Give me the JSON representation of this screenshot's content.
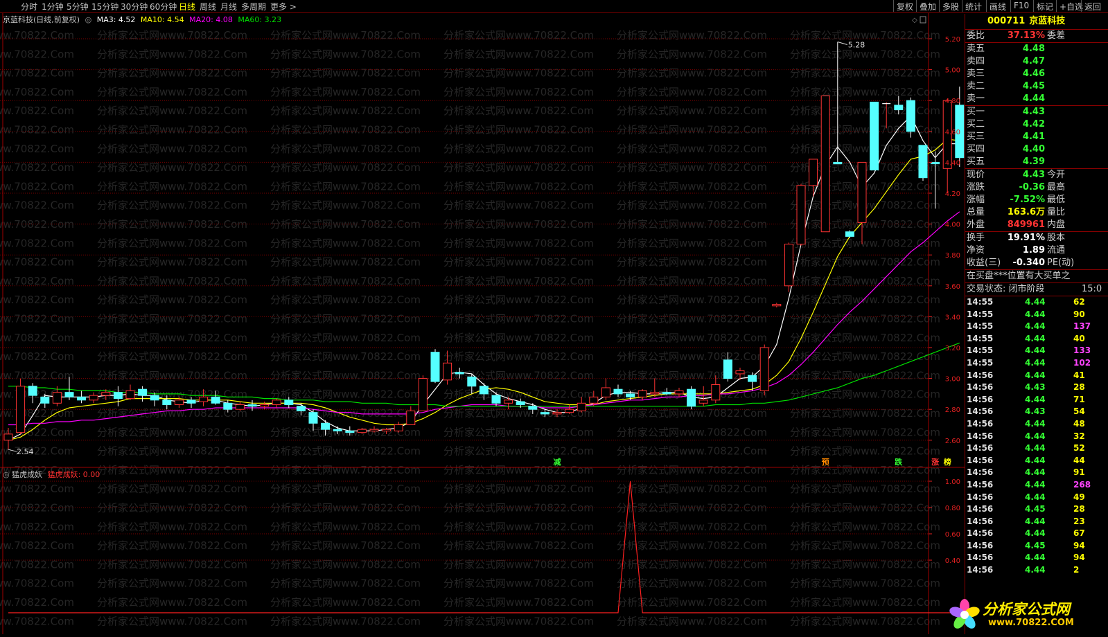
{
  "topbar": {
    "periods": [
      "分时",
      "1分钟",
      "5分钟",
      "15分钟",
      "30分钟",
      "60分钟",
      "日线",
      "周线",
      "月线",
      "多周期",
      "更多"
    ],
    "active_period": "日线",
    "tools": [
      "复权",
      "叠加",
      "多股",
      "统计",
      "画线",
      "F10",
      "标记",
      "+自选",
      "返回"
    ]
  },
  "main_info": {
    "title": "京蓝科技(日线,前复权)",
    "ma3": "MA3: 4.52",
    "ma10": "MA10: 4.54",
    "ma20": "MA20: 4.08",
    "ma60": "MA60: 3.23"
  },
  "indicator_info": {
    "name": "猛虎成妖",
    "value": "猛虎成妖: 0.00"
  },
  "watermark": "分析家公式网www.70822.Com",
  "colors": {
    "up": "#ff3333",
    "down": "#55ffff",
    "ma3": "#ffffff",
    "ma10": "#ffff00",
    "ma20": "#ff00ff",
    "ma60": "#00e000",
    "grid": "#7a0000",
    "indicator": "#ff2020"
  },
  "chart_data": {
    "type": "candlestick",
    "price_axis": {
      "ticks": [
        "5.20",
        "5.00",
        "4.80",
        "4.60",
        "4.40",
        "4.20",
        "4.00",
        "3.80",
        "3.60",
        "3.40",
        "3.20",
        "3.00",
        "2.80",
        "2.60"
      ],
      "range": [
        2.55,
        5.3
      ]
    },
    "indicator_axis": {
      "ticks": [
        "1.00",
        "0.80",
        "0.60",
        "0.40"
      ],
      "range": [
        0,
        1.0
      ]
    },
    "high_label": "5.28",
    "low_label": "2.54",
    "candles": [
      [
        2.6,
        2.64,
        2.54,
        2.68
      ],
      [
        2.65,
        2.95,
        2.64,
        3.0
      ],
      [
        2.95,
        2.89,
        2.84,
        2.97
      ],
      [
        2.88,
        2.84,
        2.81,
        2.9
      ],
      [
        2.84,
        2.91,
        2.82,
        2.95
      ],
      [
        2.91,
        2.88,
        2.86,
        3.01
      ],
      [
        2.88,
        2.86,
        2.84,
        2.92
      ],
      [
        2.86,
        2.89,
        2.84,
        2.91
      ],
      [
        2.89,
        2.91,
        2.86,
        2.93
      ],
      [
        2.91,
        2.87,
        2.82,
        2.95
      ],
      [
        2.87,
        2.92,
        2.86,
        2.96
      ],
      [
        2.93,
        2.89,
        2.85,
        2.95
      ],
      [
        2.89,
        2.86,
        2.82,
        2.91
      ],
      [
        2.86,
        2.83,
        2.8,
        2.89
      ],
      [
        2.83,
        2.86,
        2.81,
        2.88
      ],
      [
        2.86,
        2.84,
        2.81,
        2.88
      ],
      [
        2.85,
        2.88,
        2.82,
        2.93
      ],
      [
        2.88,
        2.84,
        2.83,
        2.92
      ],
      [
        2.84,
        2.8,
        2.78,
        2.86
      ],
      [
        2.8,
        2.83,
        2.79,
        2.85
      ],
      [
        2.83,
        2.82,
        2.79,
        2.86
      ],
      [
        2.82,
        2.83,
        2.8,
        2.85
      ],
      [
        2.83,
        2.86,
        2.81,
        2.87
      ],
      [
        2.86,
        2.83,
        2.81,
        2.88
      ],
      [
        2.82,
        2.79,
        2.76,
        2.84
      ],
      [
        2.78,
        2.71,
        2.66,
        2.8
      ],
      [
        2.71,
        2.67,
        2.63,
        2.73
      ],
      [
        2.67,
        2.66,
        2.64,
        2.69
      ],
      [
        2.66,
        2.65,
        2.63,
        2.69
      ],
      [
        2.65,
        2.67,
        2.64,
        2.68
      ],
      [
        2.66,
        2.67,
        2.65,
        2.69
      ],
      [
        2.66,
        2.67,
        2.64,
        2.68
      ],
      [
        2.66,
        2.7,
        2.65,
        2.72
      ],
      [
        2.7,
        2.79,
        2.7,
        2.82
      ],
      [
        2.79,
        3.0,
        2.79,
        3.02
      ],
      [
        3.17,
        2.98,
        2.97,
        3.19
      ],
      [
        2.99,
        3.1,
        2.96,
        3.18
      ],
      [
        3.04,
        3.03,
        3.0,
        3.07
      ],
      [
        3.01,
        2.95,
        2.9,
        3.03
      ],
      [
        2.95,
        2.9,
        2.86,
        2.97
      ],
      [
        2.89,
        2.84,
        2.82,
        2.91
      ],
      [
        2.84,
        2.86,
        2.8,
        2.88
      ],
      [
        2.85,
        2.83,
        2.81,
        2.87
      ],
      [
        2.82,
        2.8,
        2.77,
        2.84
      ],
      [
        2.78,
        2.77,
        2.75,
        2.8
      ],
      [
        2.77,
        2.78,
        2.75,
        2.8
      ],
      [
        2.78,
        2.8,
        2.77,
        2.83
      ],
      [
        2.79,
        2.84,
        2.78,
        2.88
      ],
      [
        2.84,
        2.88,
        2.82,
        2.92
      ],
      [
        2.88,
        2.94,
        2.86,
        3.0
      ],
      [
        2.93,
        2.9,
        2.88,
        2.96
      ],
      [
        2.9,
        2.88,
        2.86,
        2.92
      ],
      [
        2.88,
        2.92,
        2.86,
        2.93
      ],
      [
        2.9,
        2.91,
        2.88,
        3.0
      ],
      [
        2.91,
        2.9,
        2.89,
        2.94
      ],
      [
        2.9,
        2.92,
        2.88,
        2.94
      ],
      [
        2.93,
        2.82,
        2.8,
        2.95
      ],
      [
        2.84,
        2.86,
        2.82,
        2.95
      ],
      [
        2.86,
        2.96,
        2.84,
        3.02
      ],
      [
        3.12,
        3.0,
        2.98,
        3.17
      ],
      [
        3.03,
        3.05,
        2.99,
        3.07
      ],
      [
        3.02,
        2.98,
        2.92,
        3.04
      ],
      [
        2.92,
        3.2,
        2.89,
        3.22
      ],
      [
        3.47,
        3.48,
        3.46,
        3.49
      ],
      [
        3.6,
        3.87,
        3.56,
        3.88
      ],
      [
        3.87,
        4.25,
        3.86,
        4.26
      ],
      [
        4.25,
        4.42,
        4.18,
        4.4
      ],
      [
        3.95,
        4.83,
        3.95,
        4.83
      ],
      [
        4.4,
        4.39,
        4.39,
        5.18
      ],
      [
        3.95,
        3.92,
        3.91,
        3.96
      ],
      [
        4.01,
        4.4,
        3.87,
        4.4
      ],
      [
        4.79,
        4.35,
        4.4,
        4.63
      ],
      [
        4.78,
        4.78,
        4.62,
        4.79
      ],
      [
        4.77,
        4.74,
        4.71,
        4.83
      ],
      [
        4.8,
        4.6,
        4.56,
        4.82
      ],
      [
        4.51,
        4.3,
        4.28,
        4.51
      ],
      [
        4.4,
        4.39,
        4.1,
        4.47
      ],
      [
        4.36,
        4.8,
        4.2,
        4.81
      ],
      [
        4.77,
        4.43,
        4.37,
        4.89
      ]
    ],
    "series": [
      {
        "name": "MA3",
        "values": [
          2.6,
          2.64,
          2.76,
          2.89,
          2.88,
          2.88,
          2.88,
          2.88,
          2.89,
          2.89,
          2.9,
          2.89,
          2.89,
          2.86,
          2.85,
          2.84,
          2.86,
          2.86,
          2.84,
          2.83,
          2.82,
          2.83,
          2.84,
          2.84,
          2.83,
          2.78,
          2.72,
          2.68,
          2.66,
          2.66,
          2.66,
          2.67,
          2.68,
          2.72,
          2.83,
          2.93,
          3.03,
          3.04,
          3.03,
          2.96,
          2.9,
          2.87,
          2.85,
          2.83,
          2.8,
          2.78,
          2.78,
          2.81,
          2.84,
          2.89,
          2.91,
          2.91,
          2.9,
          2.9,
          2.91,
          2.91,
          2.88,
          2.87,
          2.88,
          2.94,
          3.0,
          3.01,
          3.08,
          3.22,
          3.52,
          3.87,
          4.18,
          4.38,
          4.5,
          4.4,
          4.24,
          4.33,
          4.51,
          4.62,
          4.7,
          4.54,
          4.43,
          4.52,
          4.52
        ]
      },
      {
        "name": "MA10",
        "values": [
          2.6,
          2.62,
          2.67,
          2.73,
          2.78,
          2.81,
          2.82,
          2.83,
          2.84,
          2.85,
          2.87,
          2.87,
          2.87,
          2.87,
          2.87,
          2.86,
          2.86,
          2.86,
          2.86,
          2.85,
          2.84,
          2.84,
          2.84,
          2.84,
          2.84,
          2.83,
          2.81,
          2.78,
          2.75,
          2.73,
          2.71,
          2.7,
          2.7,
          2.71,
          2.74,
          2.78,
          2.83,
          2.87,
          2.9,
          2.93,
          2.94,
          2.93,
          2.91,
          2.88,
          2.85,
          2.84,
          2.83,
          2.83,
          2.83,
          2.85,
          2.86,
          2.87,
          2.88,
          2.89,
          2.9,
          2.9,
          2.9,
          2.9,
          2.9,
          2.91,
          2.92,
          2.93,
          2.96,
          3.02,
          3.11,
          3.26,
          3.43,
          3.61,
          3.79,
          3.92,
          4.01,
          4.1,
          4.21,
          4.32,
          4.42,
          4.44,
          4.48,
          4.55,
          4.54
        ]
      },
      {
        "name": "MA20",
        "values": [
          2.7,
          2.7,
          2.71,
          2.71,
          2.72,
          2.72,
          2.73,
          2.73,
          2.74,
          2.75,
          2.76,
          2.77,
          2.78,
          2.79,
          2.79,
          2.8,
          2.8,
          2.81,
          2.81,
          2.81,
          2.81,
          2.81,
          2.81,
          2.81,
          2.81,
          2.8,
          2.79,
          2.78,
          2.78,
          2.77,
          2.77,
          2.77,
          2.77,
          2.77,
          2.78,
          2.8,
          2.81,
          2.82,
          2.83,
          2.83,
          2.83,
          2.82,
          2.82,
          2.82,
          2.81,
          2.81,
          2.81,
          2.82,
          2.83,
          2.84,
          2.85,
          2.86,
          2.86,
          2.87,
          2.88,
          2.88,
          2.89,
          2.89,
          2.9,
          2.9,
          2.91,
          2.92,
          2.94,
          2.97,
          3.02,
          3.09,
          3.17,
          3.26,
          3.35,
          3.43,
          3.5,
          3.58,
          3.66,
          3.74,
          3.82,
          3.88,
          3.95,
          4.02,
          4.08
        ]
      },
      {
        "name": "MA60",
        "values": [
          2.95,
          2.95,
          2.94,
          2.94,
          2.93,
          2.93,
          2.92,
          2.92,
          2.92,
          2.91,
          2.91,
          2.91,
          2.9,
          2.9,
          2.9,
          2.89,
          2.89,
          2.89,
          2.88,
          2.88,
          2.88,
          2.87,
          2.87,
          2.86,
          2.86,
          2.86,
          2.85,
          2.85,
          2.85,
          2.84,
          2.84,
          2.84,
          2.83,
          2.83,
          2.83,
          2.83,
          2.82,
          2.82,
          2.82,
          2.82,
          2.82,
          2.82,
          2.82,
          2.82,
          2.82,
          2.82,
          2.82,
          2.82,
          2.82,
          2.82,
          2.82,
          2.82,
          2.82,
          2.82,
          2.82,
          2.82,
          2.82,
          2.82,
          2.83,
          2.83,
          2.83,
          2.84,
          2.84,
          2.85,
          2.86,
          2.88,
          2.9,
          2.92,
          2.94,
          2.97,
          3.0,
          3.02,
          3.05,
          3.08,
          3.11,
          3.14,
          3.17,
          3.2,
          3.23
        ]
      }
    ],
    "markers": [
      {
        "index": 45,
        "text": "减",
        "color": "#33ff33"
      },
      {
        "index": 67,
        "text": "预",
        "color": "#ff8800"
      },
      {
        "index": 73,
        "text": "跌",
        "color": "#33ff33"
      },
      {
        "index": 76,
        "text": "涨",
        "color": "#ff3333"
      },
      {
        "index": 77,
        "text": "榜",
        "color": "#ffff00"
      }
    ],
    "indicator_values": [
      0,
      0,
      0,
      0,
      0,
      0,
      0,
      0,
      0,
      0,
      0,
      0,
      0,
      0,
      0,
      0,
      0,
      0,
      0,
      0,
      0,
      0,
      0,
      0,
      0,
      0,
      0,
      0,
      0,
      0,
      0,
      0,
      0,
      0,
      0,
      0,
      0,
      0,
      0,
      0,
      0,
      0,
      0,
      0,
      0,
      0,
      0,
      0,
      0,
      0,
      0,
      1.0,
      0,
      0,
      0,
      0,
      0,
      0,
      0,
      0,
      0,
      0,
      0,
      0,
      0,
      0,
      0,
      0,
      0,
      0,
      0,
      0,
      0,
      0,
      0,
      0,
      0,
      0,
      0
    ]
  },
  "quote": {
    "code": "000711",
    "name": "京蓝科技",
    "weibi_label": "委比",
    "weibi_value": "37.13%",
    "weicha_label": "委差",
    "sells": [
      {
        "label": "卖五",
        "price": "4.48"
      },
      {
        "label": "卖四",
        "price": "4.47"
      },
      {
        "label": "卖三",
        "price": "4.46"
      },
      {
        "label": "卖二",
        "price": "4.45"
      },
      {
        "label": "卖一",
        "price": "4.44"
      }
    ],
    "buys": [
      {
        "label": "买一",
        "price": "4.43"
      },
      {
        "label": "买二",
        "price": "4.42"
      },
      {
        "label": "买三",
        "price": "4.41"
      },
      {
        "label": "买四",
        "price": "4.40"
      },
      {
        "label": "买五",
        "price": "4.39"
      }
    ],
    "stats": [
      {
        "label": "现价",
        "value": "4.43",
        "color": "#33ff33",
        "right": "今开"
      },
      {
        "label": "涨跌",
        "value": "-0.36",
        "color": "#33ff33",
        "right": "最高"
      },
      {
        "label": "涨幅",
        "value": "-7.52%",
        "color": "#33ff33",
        "right": "最低"
      },
      {
        "label": "总量",
        "value": "163.6万",
        "color": "#ffff00",
        "right": "量比"
      },
      {
        "label": "外盘",
        "value": "849961",
        "color": "#ff3333",
        "right": "内盘"
      }
    ],
    "stats2": [
      {
        "label": "换手",
        "value": "19.91%",
        "right": "股本"
      },
      {
        "label": "净资",
        "value": "1.89",
        "right": "流通"
      },
      {
        "label": "收益(三)",
        "value": "-0.340",
        "right": "PE(动)"
      }
    ],
    "notice": "在买盘***位置有大买单之",
    "status": "交易状态: 闭市阶段",
    "status_time": "15:0",
    "ticks": [
      {
        "time": "14:55",
        "price": "4.44",
        "vol": "62"
      },
      {
        "time": "14:55",
        "price": "4.44",
        "vol": "90"
      },
      {
        "time": "14:55",
        "price": "4.44",
        "vol": "137"
      },
      {
        "time": "14:55",
        "price": "4.44",
        "vol": "40"
      },
      {
        "time": "14:55",
        "price": "4.44",
        "vol": "133"
      },
      {
        "time": "14:55",
        "price": "4.44",
        "vol": "102"
      },
      {
        "time": "14:56",
        "price": "4.44",
        "vol": "41"
      },
      {
        "time": "14:56",
        "price": "4.43",
        "vol": "28"
      },
      {
        "time": "14:56",
        "price": "4.44",
        "vol": "71"
      },
      {
        "time": "14:56",
        "price": "4.43",
        "vol": "54"
      },
      {
        "time": "14:56",
        "price": "4.44",
        "vol": "48"
      },
      {
        "time": "14:56",
        "price": "4.44",
        "vol": "32"
      },
      {
        "time": "14:56",
        "price": "4.44",
        "vol": "52"
      },
      {
        "time": "14:56",
        "price": "4.44",
        "vol": "44"
      },
      {
        "time": "14:56",
        "price": "4.44",
        "vol": "91"
      },
      {
        "time": "14:56",
        "price": "4.44",
        "vol": "268"
      },
      {
        "time": "14:56",
        "price": "4.44",
        "vol": "49"
      },
      {
        "time": "14:56",
        "price": "4.45",
        "vol": "28"
      },
      {
        "time": "14:56",
        "price": "4.44",
        "vol": "23"
      },
      {
        "time": "14:56",
        "price": "4.44",
        "vol": "67"
      },
      {
        "time": "14:56",
        "price": "4.45",
        "vol": "94"
      },
      {
        "time": "14:56",
        "price": "4.44",
        "vol": "94"
      },
      {
        "time": "14:56",
        "price": "4.44",
        "vol": "2"
      }
    ]
  },
  "logo": {
    "title": "分析家公式网",
    "url": "www.70822.COM"
  }
}
